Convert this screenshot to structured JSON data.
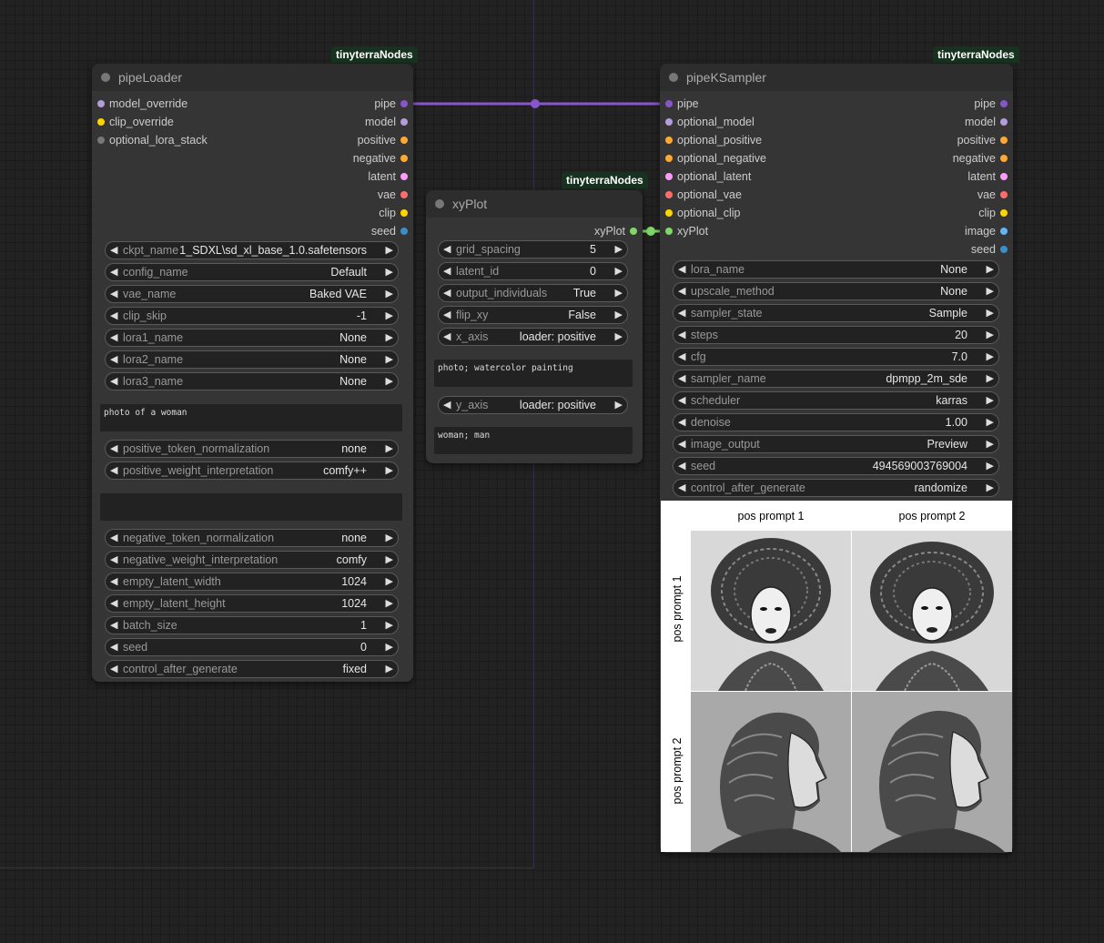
{
  "colors": {
    "pipe": "#8855cc",
    "model": "#b39ddb",
    "clip": "#ffd500",
    "conditioning": "#ffa931",
    "latent": "#ff9cf9",
    "vae": "#ff6e6e",
    "seed": "#3a8fc8",
    "image": "#64b5f6",
    "xyplot": "#7ed868",
    "lora_stack": "#777777",
    "badge_bg": "#17321f"
  },
  "pipeLoader": {
    "badge": "tinyterraNodes",
    "title": "pipeLoader",
    "inputs": [
      {
        "label": "model_override",
        "color": "#b39ddb"
      },
      {
        "label": "clip_override",
        "color": "#ffd500"
      },
      {
        "label": "optional_lora_stack",
        "color": "#777777"
      }
    ],
    "outputs": [
      {
        "label": "pipe",
        "color": "#8855cc"
      },
      {
        "label": "model",
        "color": "#b39ddb"
      },
      {
        "label": "positive",
        "color": "#ffa931"
      },
      {
        "label": "negative",
        "color": "#ffa931"
      },
      {
        "label": "latent",
        "color": "#ff9cf9"
      },
      {
        "label": "vae",
        "color": "#ff6e6e"
      },
      {
        "label": "clip",
        "color": "#ffd500"
      },
      {
        "label": "seed",
        "color": "#3a8fc8"
      }
    ],
    "widgets_a": [
      {
        "label": "ckpt_name",
        "value": "1_SDXL\\sd_xl_base_1.0.safetensors"
      },
      {
        "label": "config_name",
        "value": "Default"
      },
      {
        "label": "vae_name",
        "value": "Baked VAE"
      },
      {
        "label": "clip_skip",
        "value": "-1"
      },
      {
        "label": "lora1_name",
        "value": "None"
      },
      {
        "label": "lora2_name",
        "value": "None"
      },
      {
        "label": "lora3_name",
        "value": "None"
      }
    ],
    "positive_text": "photo of a woman",
    "widgets_b": [
      {
        "label": "positive_token_normalization",
        "value": "none"
      },
      {
        "label": "positive_weight_interpretation",
        "value": "comfy++"
      }
    ],
    "negative_text": "",
    "widgets_c": [
      {
        "label": "negative_token_normalization",
        "value": "none"
      },
      {
        "label": "negative_weight_interpretation",
        "value": "comfy"
      },
      {
        "label": "empty_latent_width",
        "value": "1024"
      },
      {
        "label": "empty_latent_height",
        "value": "1024"
      },
      {
        "label": "batch_size",
        "value": "1"
      },
      {
        "label": "seed",
        "value": "0"
      },
      {
        "label": "control_after_generate",
        "value": "fixed"
      }
    ]
  },
  "xyPlot": {
    "badge": "tinyterraNodes",
    "title": "xyPlot",
    "output": {
      "label": "xyPlot",
      "color": "#7ed868"
    },
    "widgets_a": [
      {
        "label": "grid_spacing",
        "value": "5"
      },
      {
        "label": "latent_id",
        "value": "0"
      },
      {
        "label": "output_individuals",
        "value": "True"
      },
      {
        "label": "flip_xy",
        "value": "False"
      },
      {
        "label": "x_axis",
        "value": "loader: positive"
      }
    ],
    "x_values": "photo; watercolor painting",
    "widgets_b": [
      {
        "label": "y_axis",
        "value": "loader: positive"
      }
    ],
    "y_values": "woman; man"
  },
  "pipeKSampler": {
    "badge": "tinyterraNodes",
    "title": "pipeKSampler",
    "inputs": [
      {
        "label": "pipe",
        "color": "#8855cc"
      },
      {
        "label": "optional_model",
        "color": "#b39ddb"
      },
      {
        "label": "optional_positive",
        "color": "#ffa931"
      },
      {
        "label": "optional_negative",
        "color": "#ffa931"
      },
      {
        "label": "optional_latent",
        "color": "#ff9cf9"
      },
      {
        "label": "optional_vae",
        "color": "#ff6e6e"
      },
      {
        "label": "optional_clip",
        "color": "#ffd500"
      },
      {
        "label": "xyPlot",
        "color": "#7ed868"
      }
    ],
    "outputs": [
      {
        "label": "pipe",
        "color": "#8855cc"
      },
      {
        "label": "model",
        "color": "#b39ddb"
      },
      {
        "label": "positive",
        "color": "#ffa931"
      },
      {
        "label": "negative",
        "color": "#ffa931"
      },
      {
        "label": "latent",
        "color": "#ff9cf9"
      },
      {
        "label": "vae",
        "color": "#ff6e6e"
      },
      {
        "label": "clip",
        "color": "#ffd500"
      },
      {
        "label": "image",
        "color": "#64b5f6"
      },
      {
        "label": "seed",
        "color": "#3a8fc8"
      }
    ],
    "widgets": [
      {
        "label": "lora_name",
        "value": "None"
      },
      {
        "label": "upscale_method",
        "value": "None"
      },
      {
        "label": "sampler_state",
        "value": "Sample"
      },
      {
        "label": "steps",
        "value": "20"
      },
      {
        "label": "cfg",
        "value": "7.0"
      },
      {
        "label": "sampler_name",
        "value": "dpmpp_2m_sde"
      },
      {
        "label": "scheduler",
        "value": "karras"
      },
      {
        "label": "denoise",
        "value": "1.00"
      },
      {
        "label": "image_output",
        "value": "Preview"
      },
      {
        "label": "seed",
        "value": "494569003769004"
      },
      {
        "label": "control_after_generate",
        "value": "randomize"
      }
    ],
    "preview": {
      "col_headers": [
        "pos prompt 1",
        "pos prompt 2"
      ],
      "row_headers": [
        "pos prompt 1",
        "pos prompt 2"
      ]
    }
  }
}
